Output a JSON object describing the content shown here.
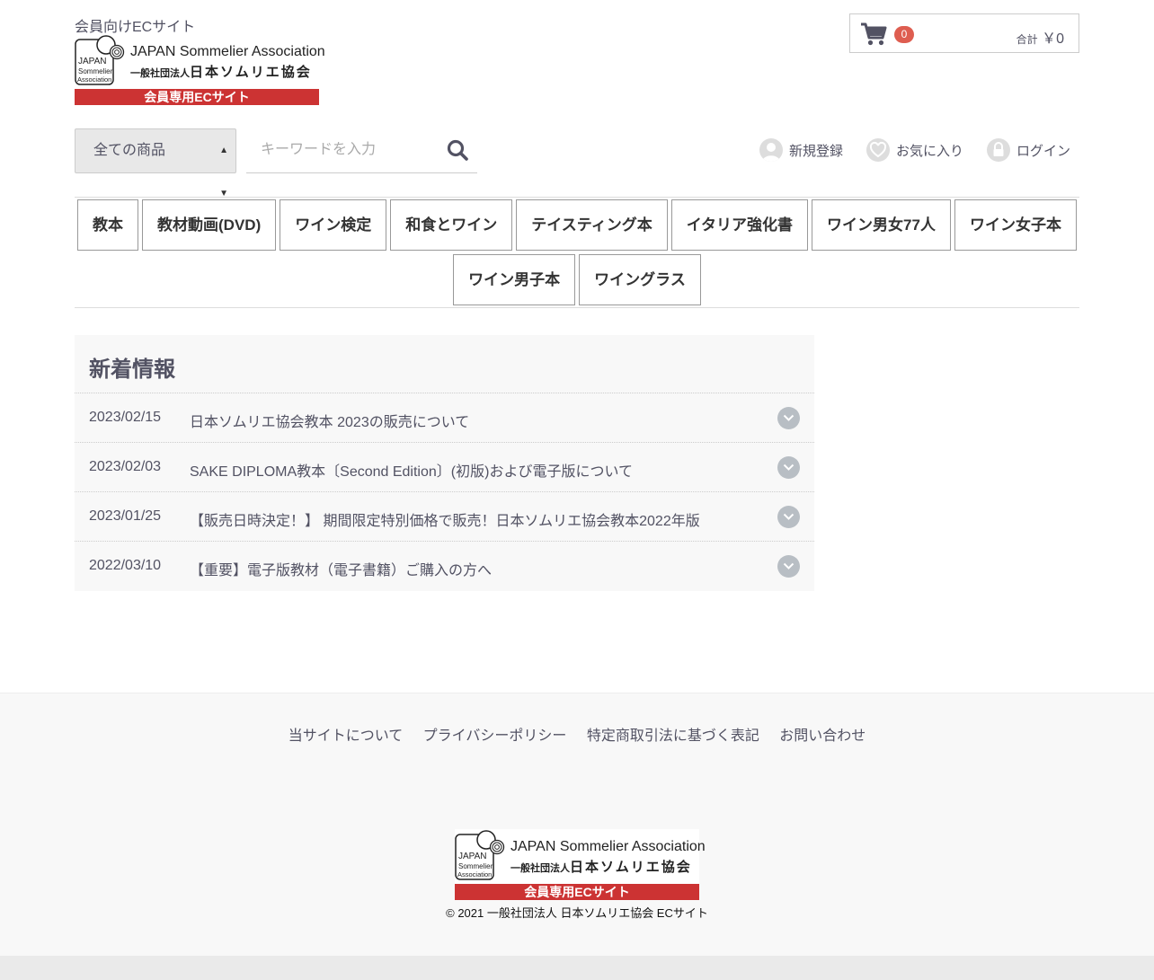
{
  "header": {
    "tagline": "会員向けECサイト",
    "logo": {
      "en": "JAPAN Sommelier Association",
      "jp_small": "一般社団法人",
      "jp_big": "日本ソムリエ協会",
      "mark_line1": "JAPAN",
      "mark_line2": "Sommelier",
      "mark_line3": "Association",
      "bar": "会員専用ECサイト"
    },
    "cart": {
      "icon": "cart-icon",
      "count": "0",
      "total_label": "合計",
      "total_value": "￥0"
    }
  },
  "search": {
    "category_selected": "全ての商品",
    "placeholder": "キーワードを入力",
    "icon": "search-icon"
  },
  "user_links": [
    {
      "label": "新規登録",
      "icon": "user-icon"
    },
    {
      "label": "お気に入り",
      "icon": "heart-icon"
    },
    {
      "label": "ログイン",
      "icon": "lock-icon"
    }
  ],
  "nav": {
    "items": [
      "教本",
      "教材動画(DVD)",
      "ワイン検定",
      "和食とワイン",
      "テイスティング本",
      "イタリア強化書",
      "ワイン男女77人",
      "ワイン女子本",
      "ワイン男子本",
      "ワイングラス"
    ]
  },
  "news": {
    "heading": "新着情報",
    "items": [
      {
        "date": "2023/02/15",
        "title": "日本ソムリエ協会教本 2023の販売について"
      },
      {
        "date": "2023/02/03",
        "title": "SAKE DIPLOMA教本〔Second Edition〕(初版)および電子版について"
      },
      {
        "date": "2023/01/25",
        "title": "【販売日時決定！】 期間限定特別価格で販売！日本ソムリエ協会教本2022年版"
      },
      {
        "date": "2022/03/10",
        "title": "【重要】電子版教材（電子書籍）ご購入の方へ"
      }
    ]
  },
  "footer": {
    "links": [
      "当サイトについて",
      "プライバシーポリシー",
      "特定商取引法に基づく表記",
      "お問い合わせ"
    ],
    "copyright": "© 2021 一般社団法人 日本ソムリエ協会 ECサイト"
  },
  "colors": {
    "accent": "#cc3333",
    "badge": "#de5d50",
    "text": "#525263",
    "panel": "#f8f8f8"
  }
}
